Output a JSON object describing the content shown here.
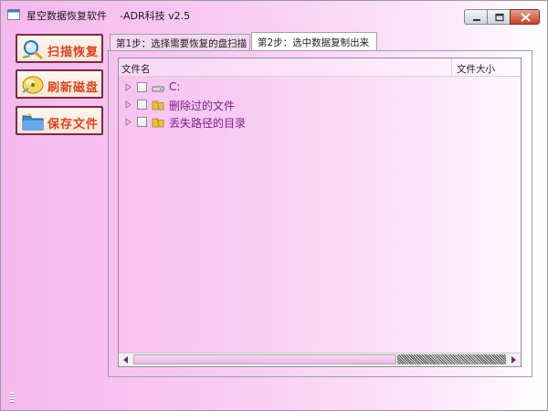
{
  "window": {
    "title": "星空数据恢复软件    -ADR科技 v2.5"
  },
  "sidebar": {
    "buttons": [
      {
        "label": "扫描恢复",
        "icon": "magnifier-icon"
      },
      {
        "label": "刷新磁盘",
        "icon": "disk-icon"
      },
      {
        "label": "保存文件",
        "icon": "folder-icon"
      }
    ]
  },
  "tabs": [
    {
      "label": "第1步：选择需要恢复的盘扫描",
      "selected": false
    },
    {
      "label": "第2步：选中数据复制出来",
      "selected": true
    }
  ],
  "file_list": {
    "columns": [
      "文件名",
      "文件大小"
    ],
    "rows": [
      {
        "label": "C:",
        "icon": "drive-icon",
        "checked": false
      },
      {
        "label": "删除过的文件",
        "icon": "folder-icon",
        "checked": false
      },
      {
        "label": "丢失路径的目录",
        "icon": "folder-icon",
        "checked": false
      }
    ]
  },
  "colors": {
    "accent_text": "#e0421c",
    "row_text": "#7d1f86",
    "background": "#f6b8ee"
  }
}
